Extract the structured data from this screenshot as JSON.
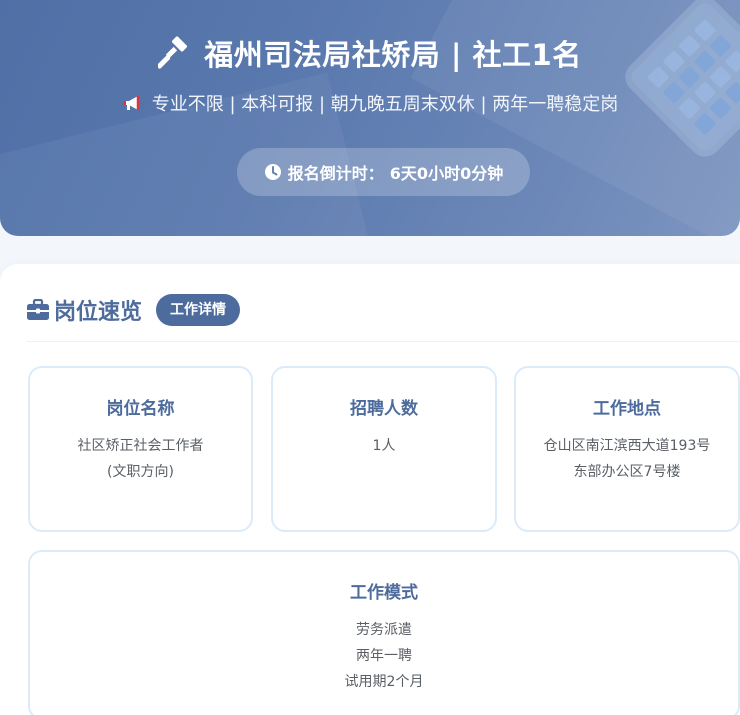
{
  "hero": {
    "title": "福州司法局社矫局 | 社工1名",
    "subtitle": "专业不限 | 本科可报 | 朝九晚五周末双休 | 两年一聘稳定岗",
    "countdown_label": "报名倒计时：",
    "countdown_value": "6天0小时0分钟",
    "icons": {
      "title": "gavel-icon",
      "subtitle": "megaphone-icon",
      "countdown": "clock-icon"
    }
  },
  "section": {
    "title": "岗位速览",
    "badge": "工作详情",
    "icon": "briefcase-icon"
  },
  "cards": [
    {
      "title": "岗位名称",
      "lines": [
        "社区矫正社会工作者",
        "(文职方向)"
      ]
    },
    {
      "title": "招聘人数",
      "lines": [
        "1人"
      ]
    },
    {
      "title": "工作地点",
      "lines": [
        "仓山区南江滨西大道193号",
        "东部办公区7号楼"
      ]
    },
    {
      "title": "工作模式",
      "lines": [
        "劳务派遣",
        "两年一聘",
        "试用期2个月"
      ]
    }
  ],
  "colors": {
    "accent": "#4d6b9d",
    "hero_start": "#4f6fa6",
    "hero_end": "#7d95c0",
    "card_border": "#dcebfa"
  }
}
